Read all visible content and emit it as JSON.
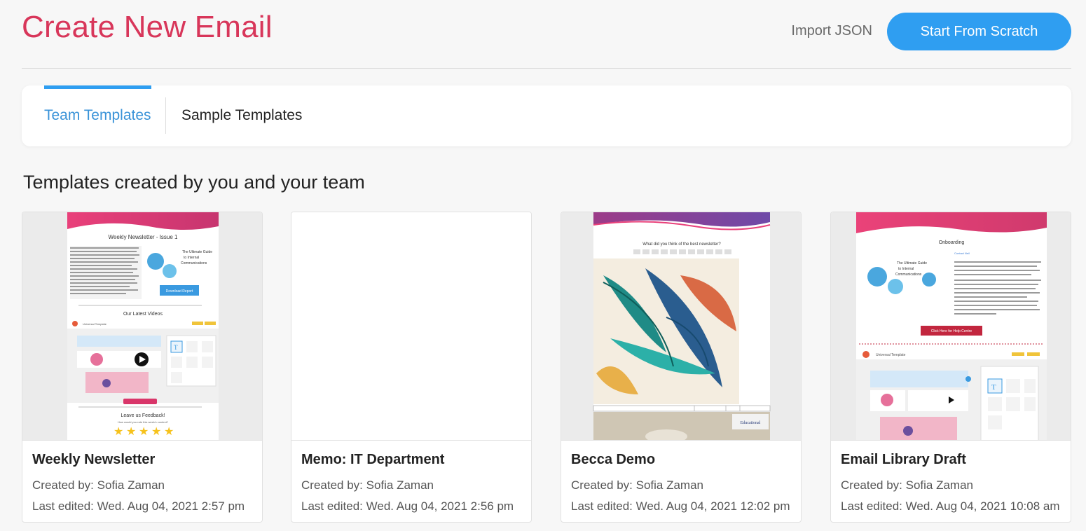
{
  "header": {
    "title": "Create New Email",
    "import_label": "Import JSON",
    "scratch_label": "Start From Scratch"
  },
  "tabs": [
    {
      "label": "Team Templates",
      "active": true
    },
    {
      "label": "Sample Templates",
      "active": false
    }
  ],
  "section_heading": "Templates created by you and your team",
  "colors": {
    "title": "#d8365a",
    "accent": "#2f9ef1",
    "active_tab": "#3a93d8"
  },
  "templates": [
    {
      "name": "Weekly Newsletter",
      "created_by": "Created by: Sofia Zaman",
      "last_edited": "Last edited: Wed. Aug 04, 2021 2:57 pm",
      "preview": "newsletter",
      "preview_text": {
        "heading": "Weekly Newsletter - Issue 1",
        "guide_line1": "The Ultimate Guide",
        "guide_line2": "to Internal",
        "guide_line3": "Communications",
        "button": "Download Report",
        "videos": "Our Latest Videos",
        "app_name": "Universal Template",
        "feedback": "Leave us Feedback!",
        "rate": "How would you rate this week's content?"
      }
    },
    {
      "name": "Memo: IT Department",
      "created_by": "Created by: Sofia Zaman",
      "last_edited": "Last edited: Wed. Aug 04, 2021 2:56 pm",
      "preview": "blank"
    },
    {
      "name": "Becca Demo",
      "created_by": "Created by: Sofia Zaman",
      "last_edited": "Last edited: Wed. Aug 04, 2021 12:02 pm",
      "preview": "survey",
      "preview_text": {
        "question": "What did you think of the best newsletter?",
        "logo": "Educational"
      }
    },
    {
      "name": "Email Library Draft",
      "created_by": "Created by: Sofia Zaman",
      "last_edited": "Last edited: Wed. Aug 04, 2021 10:08 am",
      "preview": "onboarding",
      "preview_text": {
        "heading": "Onboarding",
        "contact": "Contact Neil",
        "guide_line1": "The Ultimate Guide",
        "guide_line2": "to Internal",
        "guide_line3": "Communications",
        "button": "Click Here for Help Centre",
        "app_name": "Universal Template"
      }
    }
  ]
}
